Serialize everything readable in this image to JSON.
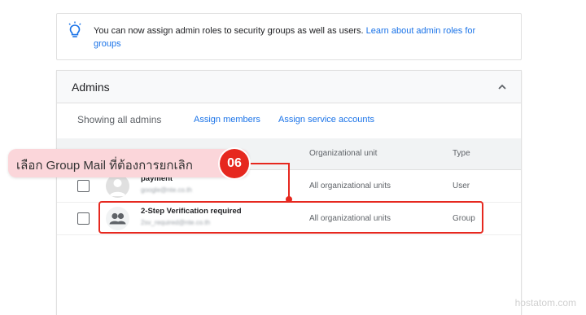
{
  "info": {
    "message": "You can now assign admin roles to security groups as well as users. ",
    "link": "Learn about admin roles for groups"
  },
  "panel": {
    "title": "Admins",
    "showing": "Showing all admins",
    "assign_members": "Assign members",
    "assign_service_accounts": "Assign service accounts"
  },
  "table": {
    "columns": {
      "org_unit": "Organizational unit",
      "type": "Type"
    },
    "rows": [
      {
        "name": "payment",
        "email": "google@nte.co.th",
        "org_unit": "All organizational units",
        "type": "User",
        "avatar": "person-icon"
      },
      {
        "name": "2-Step Verification required",
        "email": "2sv_required@nte.co.th",
        "org_unit": "All organizational units",
        "type": "Group",
        "avatar": "group-icon"
      }
    ]
  },
  "annotation": {
    "instruction": "เลือก Group Mail ที่ต้องการยกเลิก",
    "step": "06",
    "color": "#e6281f"
  },
  "watermark": "hostatom.com"
}
